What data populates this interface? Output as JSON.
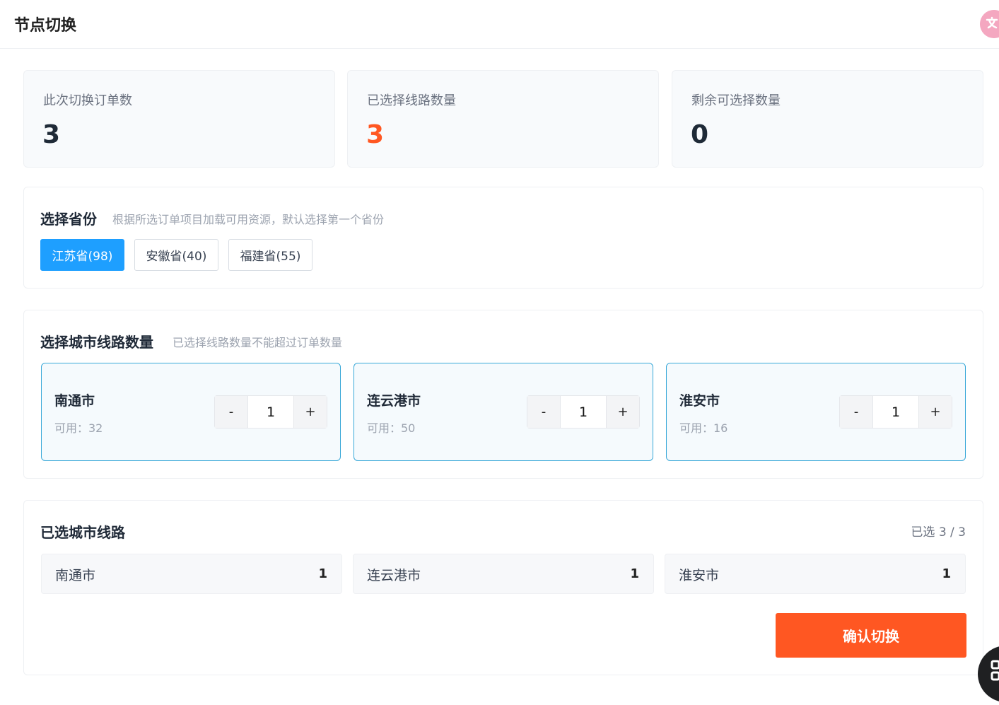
{
  "header": {
    "title": "节点切换"
  },
  "stats": [
    {
      "label": "此次切换订单数",
      "value": "3"
    },
    {
      "label": "已选择线路数量",
      "value": "3"
    },
    {
      "label": "剩余可选择数量",
      "value": "0"
    }
  ],
  "province": {
    "title": "选择省份",
    "hint": "根据所选订单项目加载可用资源，默认选择第一个省份",
    "options": [
      {
        "label": "江苏省(98)",
        "active": true
      },
      {
        "label": "安徽省(40)",
        "active": false
      },
      {
        "label": "福建省(55)",
        "active": false
      }
    ]
  },
  "city": {
    "title": "选择城市线路数量",
    "hint": "已选择线路数量不能超过订单数量",
    "cards": [
      {
        "name": "南通市",
        "available": "可用：32",
        "qty": "1"
      },
      {
        "name": "连云港市",
        "available": "可用：50",
        "qty": "1"
      },
      {
        "name": "淮安市",
        "available": "可用：16",
        "qty": "1"
      }
    ],
    "minus": "-",
    "plus": "+"
  },
  "selected": {
    "title": "已选城市线路",
    "counter": "已选 3 / 3",
    "items": [
      {
        "name": "南通市",
        "count": "1"
      },
      {
        "name": "连云港市",
        "count": "1"
      },
      {
        "name": "淮安市",
        "count": "1"
      }
    ],
    "confirm_label": "确认切换"
  },
  "colors": {
    "primary": "#1e9fff",
    "accent": "#ff5722",
    "card_border": "#38a8d8"
  }
}
